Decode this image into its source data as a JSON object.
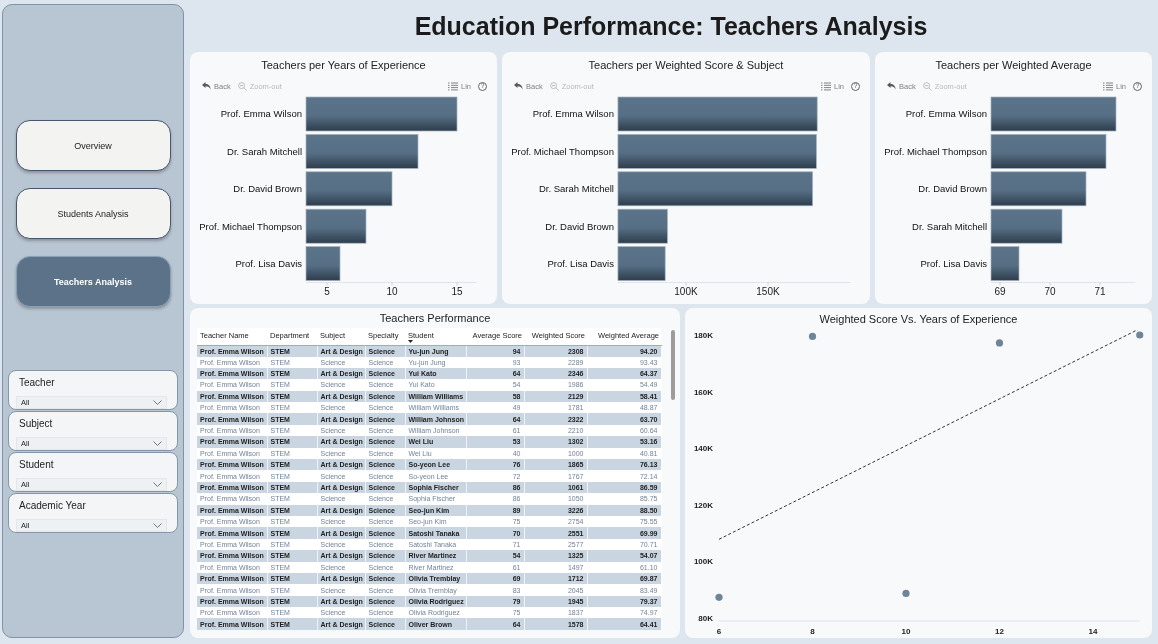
{
  "dashboard": {
    "title": "Education Performance: Teachers Analysis"
  },
  "navigation": [
    {
      "label": "Overview",
      "selected": false
    },
    {
      "label": "Students Analysis",
      "selected": false
    },
    {
      "label": "Teachers Analysis",
      "selected": true
    }
  ],
  "filters": [
    {
      "label": "Teacher",
      "value": "All"
    },
    {
      "label": "Subject",
      "value": "All"
    },
    {
      "label": "Student",
      "value": "All"
    },
    {
      "label": "Academic Year",
      "value": "All"
    }
  ],
  "bar_charts": [
    {
      "toolbar": [
        {
          "kind": "back",
          "label": "Back",
          "disabled": false
        },
        {
          "kind": "zoom-out",
          "label": "Zoom-out",
          "disabled": true
        },
        {
          "kind": "scale",
          "label": "Lin",
          "disabled": false
        },
        {
          "kind": "help",
          "label": "?",
          "disabled": false
        }
      ],
      "chart_data": {
        "type": "bar",
        "orientation": "horizontal",
        "title": "Teachers per Years of Experience",
        "categories": [
          "Prof. Emma Wilson",
          "Dr. Sarah Mitchell",
          "Dr. David Brown",
          "Prof. Michael Thompson",
          "Prof. Lisa Davis"
        ],
        "values": [
          15,
          12,
          10,
          8,
          6
        ],
        "xlim": [
          3.385,
          16.5
        ],
        "xticks": [
          5,
          10,
          15
        ]
      }
    },
    {
      "toolbar": [
        {
          "kind": "back",
          "label": "Back",
          "disabled": false
        },
        {
          "kind": "zoom-out",
          "label": "Zoom-out",
          "disabled": true
        },
        {
          "kind": "scale",
          "label": "Lin",
          "disabled": false
        },
        {
          "kind": "help",
          "label": "?",
          "disabled": false
        }
      ],
      "chart_data": {
        "type": "bar",
        "orientation": "horizontal",
        "title": "Teachers per Weighted Score & Subject",
        "categories": [
          "Prof. Emma Wilson",
          "Prof. Michael Thompson",
          "Dr. Sarah Mitchell",
          "Dr. David Brown",
          "Prof. Lisa Davis"
        ],
        "values": [
          180000,
          179500,
          177200,
          88700,
          87300
        ],
        "xlim": [
          58500,
          200000
        ],
        "xticks": [
          {
            "value": 100000,
            "label": "100K"
          },
          {
            "value": 150000,
            "label": "150K"
          }
        ]
      }
    },
    {
      "toolbar": [
        {
          "kind": "back",
          "label": "Back",
          "disabled": false
        },
        {
          "kind": "zoom-out",
          "label": "Zoom-out",
          "disabled": true
        },
        {
          "kind": "scale",
          "label": "Lin",
          "disabled": false
        },
        {
          "kind": "help",
          "label": "?",
          "disabled": false
        }
      ],
      "chart_data": {
        "type": "bar",
        "orientation": "horizontal",
        "title": "Teachers per Weighted Average",
        "categories": [
          "Prof. Emma Wilson",
          "Prof. Michael Thompson",
          "Dr. David Brown",
          "Dr. Sarah Mitchell",
          "Prof. Lisa Davis"
        ],
        "values": [
          71.32,
          71.12,
          70.72,
          70.24,
          69.38
        ],
        "xlim": [
          68.82,
          71.7
        ],
        "xticks": [
          69,
          70,
          71
        ]
      }
    }
  ],
  "table": {
    "title": "Teachers Performance",
    "columns": [
      {
        "label": "Teacher Name",
        "kind": "text",
        "sorted": false
      },
      {
        "label": "Department",
        "kind": "text",
        "sorted": false
      },
      {
        "label": "Subject",
        "kind": "text",
        "sorted": false
      },
      {
        "label": "Specialty",
        "kind": "text",
        "sorted": false
      },
      {
        "label": "Student",
        "kind": "text",
        "sorted": true
      },
      {
        "label": "Average Score",
        "kind": "number",
        "sorted": false
      },
      {
        "label": "Weighted Score",
        "kind": "number",
        "sorted": false
      },
      {
        "label": "Weighted Average",
        "kind": "number",
        "sorted": false
      }
    ],
    "rows": [
      [
        "Prof. Emma Wilson",
        "STEM",
        "Art & Design",
        "Science",
        "Yu-jun Jung",
        "94",
        "2308",
        "94.20"
      ],
      [
        "Prof. Emma Wilson",
        "STEM",
        "Science",
        "Science",
        "Yu-jun Jung",
        "93",
        "2289",
        "93.43"
      ],
      [
        "Prof. Emma Wilson",
        "STEM",
        "Art & Design",
        "Science",
        "Yui Kato",
        "64",
        "2346",
        "64.37"
      ],
      [
        "Prof. Emma Wilson",
        "STEM",
        "Science",
        "Science",
        "Yui Kato",
        "54",
        "1986",
        "54.49"
      ],
      [
        "Prof. Emma Wilson",
        "STEM",
        "Art & Design",
        "Science",
        "William Williams",
        "58",
        "2129",
        "58.41"
      ],
      [
        "Prof. Emma Wilson",
        "STEM",
        "Science",
        "Science",
        "William Williams",
        "49",
        "1781",
        "48.87"
      ],
      [
        "Prof. Emma Wilson",
        "STEM",
        "Art & Design",
        "Science",
        "William Johnson",
        "64",
        "2322",
        "63.70"
      ],
      [
        "Prof. Emma Wilson",
        "STEM",
        "Science",
        "Science",
        "William Johnson",
        "61",
        "2210",
        "60.64"
      ],
      [
        "Prof. Emma Wilson",
        "STEM",
        "Art & Design",
        "Science",
        "Wei Liu",
        "53",
        "1302",
        "53.16"
      ],
      [
        "Prof. Emma Wilson",
        "STEM",
        "Science",
        "Science",
        "Wei Liu",
        "40",
        "1000",
        "40.81"
      ],
      [
        "Prof. Emma Wilson",
        "STEM",
        "Art & Design",
        "Science",
        "So-yeon Lee",
        "76",
        "1865",
        "76.13"
      ],
      [
        "Prof. Emma Wilson",
        "STEM",
        "Science",
        "Science",
        "So-yeon Lee",
        "72",
        "1767",
        "72.14"
      ],
      [
        "Prof. Emma Wilson",
        "STEM",
        "Art & Design",
        "Science",
        "Sophia Fischer",
        "86",
        "1061",
        "86.59"
      ],
      [
        "Prof. Emma Wilson",
        "STEM",
        "Science",
        "Science",
        "Sophia Fischer",
        "86",
        "1050",
        "85.75"
      ],
      [
        "Prof. Emma Wilson",
        "STEM",
        "Art & Design",
        "Science",
        "Seo-jun Kim",
        "89",
        "3226",
        "88.50"
      ],
      [
        "Prof. Emma Wilson",
        "STEM",
        "Science",
        "Science",
        "Seo-jun Kim",
        "75",
        "2754",
        "75.55"
      ],
      [
        "Prof. Emma Wilson",
        "STEM",
        "Art & Design",
        "Science",
        "Satoshi Tanaka",
        "70",
        "2551",
        "69.99"
      ],
      [
        "Prof. Emma Wilson",
        "STEM",
        "Science",
        "Science",
        "Satoshi Tanaka",
        "71",
        "2577",
        "70.71"
      ],
      [
        "Prof. Emma Wilson",
        "STEM",
        "Art & Design",
        "Science",
        "River Martinez",
        "54",
        "1325",
        "54.07"
      ],
      [
        "Prof. Emma Wilson",
        "STEM",
        "Science",
        "Science",
        "River Martinez",
        "61",
        "1497",
        "61.10"
      ],
      [
        "Prof. Emma Wilson",
        "STEM",
        "Art & Design",
        "Science",
        "Olivia Tremblay",
        "69",
        "1712",
        "69.87"
      ],
      [
        "Prof. Emma Wilson",
        "STEM",
        "Science",
        "Science",
        "Olivia Tremblay",
        "83",
        "2045",
        "83.49"
      ],
      [
        "Prof. Emma Wilson",
        "STEM",
        "Art & Design",
        "Science",
        "Olivia Rodriguez",
        "79",
        "1945",
        "79.37"
      ],
      [
        "Prof. Emma Wilson",
        "STEM",
        "Science",
        "Science",
        "Olivia Rodriguez",
        "75",
        "1837",
        "74.97"
      ],
      [
        "Prof. Emma Wilson",
        "STEM",
        "Art & Design",
        "Science",
        "Oliver Brown",
        "64",
        "1578",
        "64.41"
      ]
    ]
  },
  "scatter_chart": {
    "chart_data": {
      "type": "scatter",
      "title": "Weighted Score Vs. Years of Experience",
      "x": [
        6,
        8,
        10,
        12,
        15
      ],
      "values": [
        87300,
        179500,
        88700,
        177200,
        180000
      ],
      "xlim": [
        6,
        15
      ],
      "ylim": [
        80000,
        180000
      ],
      "xticks": [
        6,
        8,
        10,
        12,
        14
      ],
      "yticks": [
        {
          "value": 80000,
          "label": "80K"
        },
        {
          "value": 100000,
          "label": "100K"
        },
        {
          "value": 120000,
          "label": "120K"
        },
        {
          "value": 140000,
          "label": "140K"
        },
        {
          "value": 160000,
          "label": "160K"
        },
        {
          "value": 180000,
          "label": "180K"
        }
      ]
    }
  }
}
